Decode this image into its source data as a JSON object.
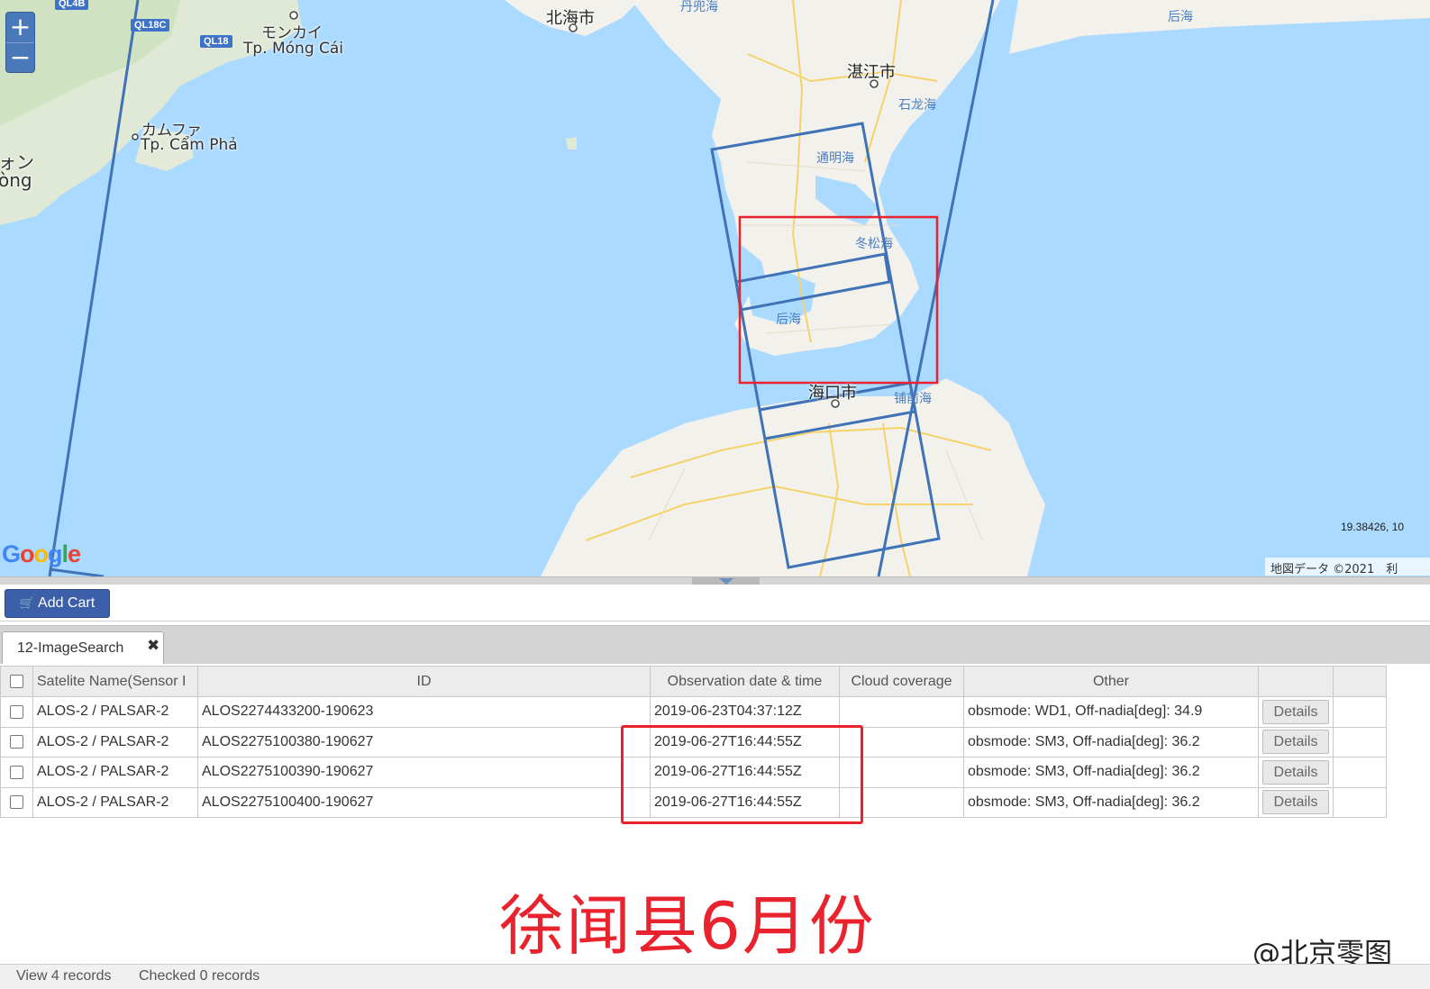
{
  "map": {
    "zoom_in": "+",
    "zoom_out": "−",
    "labels": {
      "beihai": "北海市",
      "zhanjiang": "湛江市",
      "shilonghai": "石龙海",
      "tongminghai": "通明海",
      "dongsonghai": "冬松海",
      "houhai_bay": "后海",
      "houhai_top": "后海",
      "haikou": "海口市",
      "puqianhai": "铺前海",
      "danjianhai": "丹兜海",
      "mongcai_jp": "モンカイ",
      "mongcai": "Tp. Móng Cái",
      "campha_jp": "カムファ",
      "campha": "Tp. Cẩm Phả",
      "hongai_jp": "ォン",
      "hongai": "òng"
    },
    "road_shields": [
      "QL4B",
      "QL18C",
      "QL18"
    ],
    "coords_readout": "19.38426, 10",
    "attribution": "地図データ ©2021　利",
    "logo": "Google"
  },
  "toolbar": {
    "add_cart_label": "Add Cart",
    "cart_icon": "🛒"
  },
  "tabs": [
    {
      "label": "12-ImageSearch",
      "close": "✖"
    }
  ],
  "grid": {
    "columns": [
      "Satelite Name(Sensor I",
      "ID",
      "Observation date & time",
      "Cloud coverage",
      "Other",
      "",
      ""
    ],
    "rows": [
      {
        "satellite": "ALOS-2 / PALSAR-2",
        "id": "ALOS2274433200-190623",
        "obs": "2019-06-23T04:37:12Z",
        "cloud": "",
        "other": "obsmode: WD1, Off-nadia[deg]: 34.9",
        "action": "Details"
      },
      {
        "satellite": "ALOS-2 / PALSAR-2",
        "id": "ALOS2275100380-190627",
        "obs": "2019-06-27T16:44:55Z",
        "cloud": "",
        "other": "obsmode: SM3, Off-nadia[deg]: 36.2",
        "action": "Details"
      },
      {
        "satellite": "ALOS-2 / PALSAR-2",
        "id": "ALOS2275100390-190627",
        "obs": "2019-06-27T16:44:55Z",
        "cloud": "",
        "other": "obsmode: SM3, Off-nadia[deg]: 36.2",
        "action": "Details"
      },
      {
        "satellite": "ALOS-2 / PALSAR-2",
        "id": "ALOS2275100400-190627",
        "obs": "2019-06-27T16:44:55Z",
        "cloud": "",
        "other": "obsmode: SM3, Off-nadia[deg]: 36.2",
        "action": "Details"
      }
    ]
  },
  "annotation": {
    "caption": "徐闻县6月份",
    "watermark": "@北京零图",
    "highlight_color": "#e8232e"
  },
  "status": {
    "view": "View 4 records",
    "checked": "Checked 0 records"
  },
  "colors": {
    "footprint": "#3f72b6",
    "aoi": "#e8232e",
    "water": "#aadaff",
    "land": "#f2f1ec",
    "button": "#3b5fa8"
  }
}
